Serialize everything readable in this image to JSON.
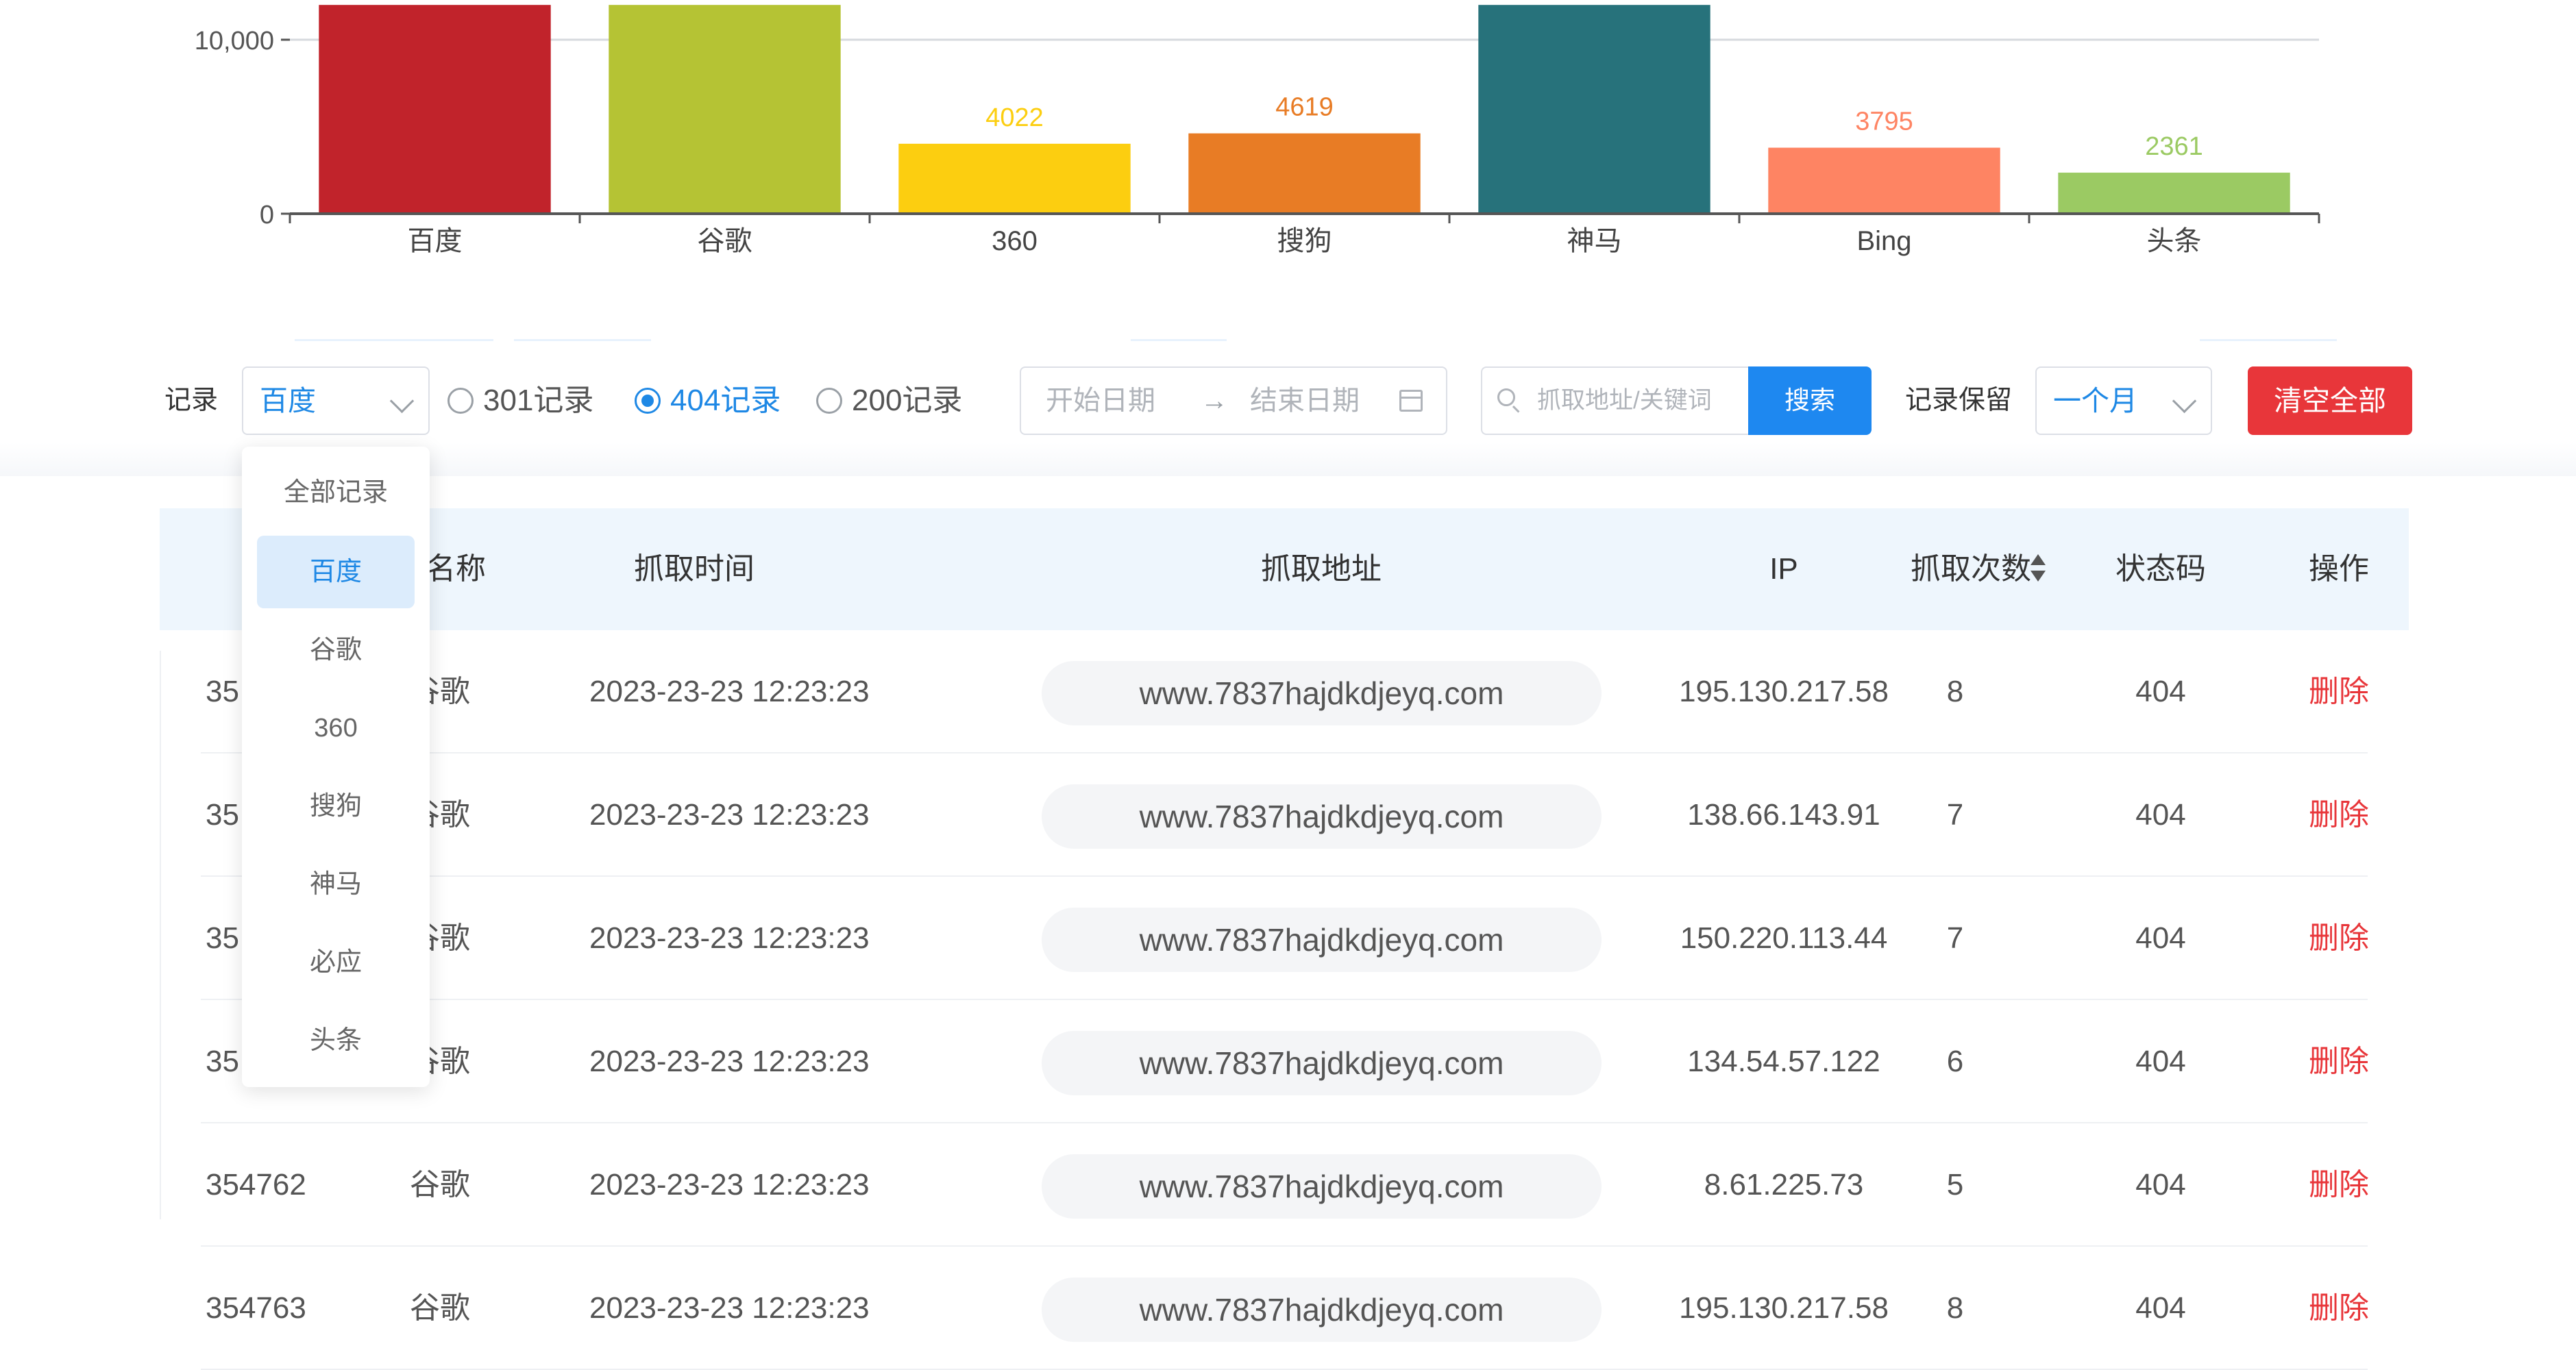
{
  "chart_data": {
    "type": "bar",
    "categories": [
      "百度",
      "谷歌",
      "360",
      "搜狗",
      "神马",
      "Bing",
      "头条"
    ],
    "values": [
      12000,
      12000,
      4022,
      4619,
      12000,
      3795,
      2361
    ],
    "data_labels": [
      "",
      "",
      "4022",
      "4619",
      "",
      "3795",
      "2361"
    ],
    "colors": [
      "#c1232b",
      "#b5c334",
      "#fcce10",
      "#e87c25",
      "#27727b",
      "#fe8463",
      "#9bca63"
    ],
    "y_ticks": [
      "0",
      "10,000"
    ],
    "y_tick_values": [
      0,
      10000
    ],
    "ylim": [
      0,
      12000
    ],
    "grid": true
  },
  "filter": {
    "record_label": "记录",
    "engine_select": {
      "value": "百度"
    },
    "radios": [
      {
        "label": "301记录",
        "checked": false
      },
      {
        "label": "404记录",
        "checked": true
      },
      {
        "label": "200记录",
        "checked": false
      }
    ],
    "date_range": {
      "start_placeholder": "开始日期",
      "separator": "→",
      "end_placeholder": "结束日期"
    },
    "search": {
      "placeholder": "抓取地址/关键词",
      "button_label": "搜索"
    },
    "retention_label": "记录保留",
    "retention_select": {
      "value": "一个月"
    },
    "clear_all_label": "清空全部"
  },
  "dropdown": {
    "items": [
      "全部记录",
      "百度",
      "谷歌",
      "360",
      "搜狗",
      "神马",
      "必应",
      "头条"
    ],
    "active": "百度"
  },
  "table": {
    "headers": {
      "engine": "擎名称",
      "time": "抓取时间",
      "url": "抓取地址",
      "ip": "IP",
      "count": "抓取次数",
      "status": "状态码",
      "action": "操作"
    },
    "rows": [
      {
        "id": "35",
        "engine": "谷歌",
        "time": "2023-23-23 12:23:23",
        "url": "www.7837hajdkdjeyq.com",
        "ip": "195.130.217.58",
        "count": "8",
        "status": "404",
        "action": "删除"
      },
      {
        "id": "35",
        "engine": "谷歌",
        "time": "2023-23-23 12:23:23",
        "url": "www.7837hajdkdjeyq.com",
        "ip": "138.66.143.91",
        "count": "7",
        "status": "404",
        "action": "删除"
      },
      {
        "id": "35",
        "engine": "谷歌",
        "time": "2023-23-23 12:23:23",
        "url": "www.7837hajdkdjeyq.com",
        "ip": "150.220.113.44",
        "count": "7",
        "status": "404",
        "action": "删除"
      },
      {
        "id": "35",
        "engine": "谷歌",
        "time": "2023-23-23 12:23:23",
        "url": "www.7837hajdkdjeyq.com",
        "ip": "134.54.57.122",
        "count": "6",
        "status": "404",
        "action": "删除"
      },
      {
        "id": "354762",
        "engine": "谷歌",
        "time": "2023-23-23 12:23:23",
        "url": "www.7837hajdkdjeyq.com",
        "ip": "8.61.225.73",
        "count": "5",
        "status": "404",
        "action": "删除"
      },
      {
        "id": "354763",
        "engine": "谷歌",
        "time": "2023-23-23 12:23:23",
        "url": "www.7837hajdkdjeyq.com",
        "ip": "195.130.217.58",
        "count": "8",
        "status": "404",
        "action": "删除"
      }
    ]
  },
  "colors": {
    "accent": "#1e88e5",
    "danger": "#e8363a",
    "header_bg": "#eef6fd"
  }
}
